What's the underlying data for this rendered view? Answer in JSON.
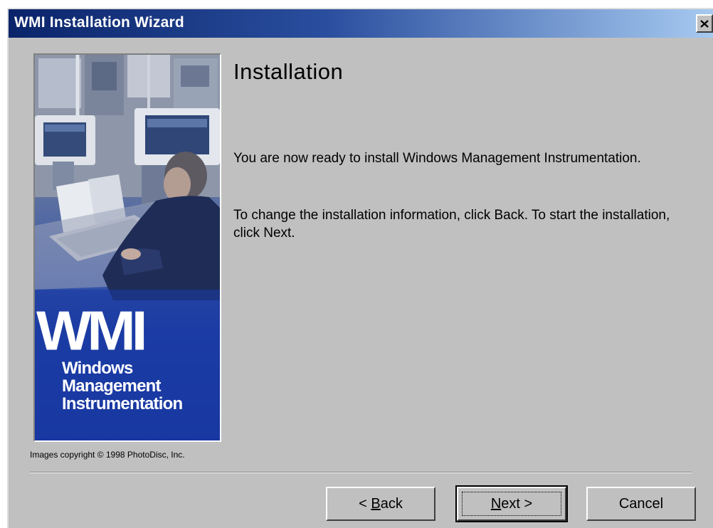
{
  "window": {
    "title": "WMI Installation Wizard",
    "close_icon": "close-icon"
  },
  "side_panel": {
    "logo_letters": "WMI",
    "logo_line1": "Windows",
    "logo_line2": "Management",
    "logo_line3": "Instrumentation",
    "copyright": "Images copyright © 1998 PhotoDisc, Inc."
  },
  "content": {
    "heading": "Installation",
    "paragraph1": "You are now ready to install Windows Management Instrumentation.",
    "paragraph2": "To change the installation information, click Back. To start the installation, click Next."
  },
  "buttons": {
    "back_prefix": "< ",
    "back_mnemonic": "B",
    "back_rest": "ack",
    "next_mnemonic": "N",
    "next_rest": "ext >",
    "cancel": "Cancel"
  },
  "colors": {
    "titlebar_start": "#0a246a",
    "titlebar_end": "#a6caf0",
    "dialog_face": "#c0c0c0",
    "panel_blue": "#1534a0"
  }
}
